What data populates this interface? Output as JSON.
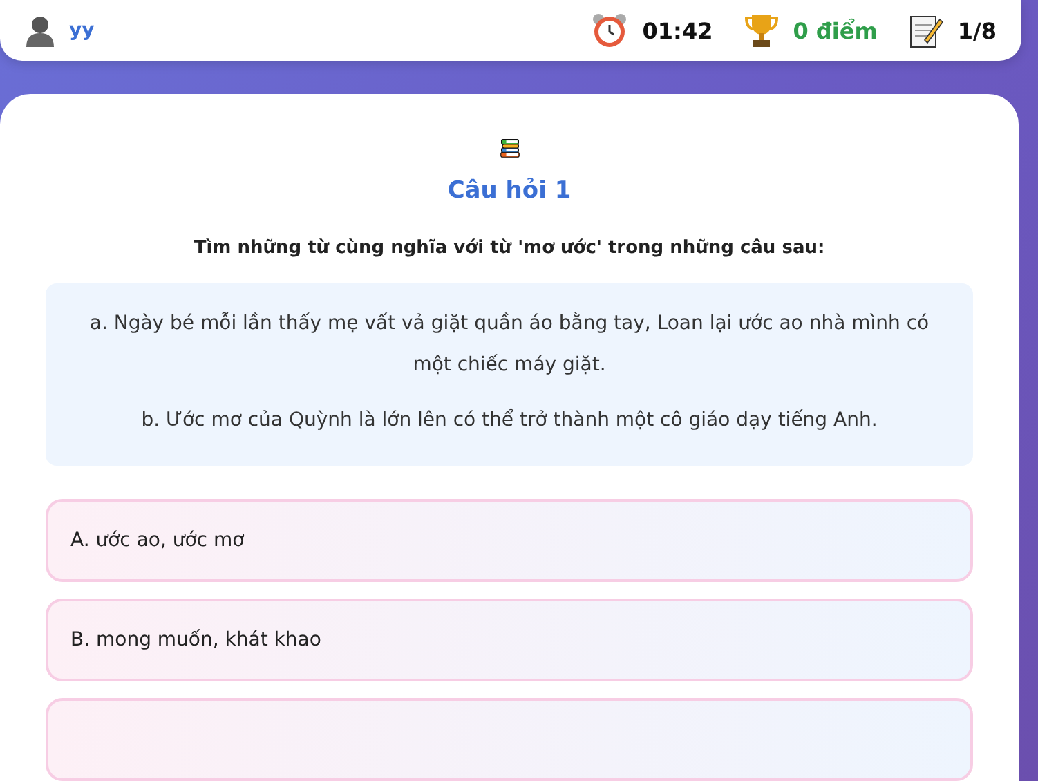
{
  "header": {
    "username": "yy",
    "timer": "01:42",
    "score": "0 điểm",
    "progress": "1/8"
  },
  "question": {
    "title": "Câu hỏi 1",
    "prompt": "Tìm những từ cùng nghĩa với từ 'mơ ước' trong những câu sau:",
    "passages": [
      "a. Ngày bé mỗi lần thấy mẹ vất vả giặt quần áo bằng tay, Loan lại ước ao nhà mình có một chiếc máy giặt.",
      "b. Ước mơ của Quỳnh là lớn lên có thể trở thành một cô giáo dạy tiếng Anh."
    ]
  },
  "options": [
    {
      "label": "A. ước ao, ước mơ"
    },
    {
      "label": "B. mong muốn, khát khao"
    }
  ]
}
